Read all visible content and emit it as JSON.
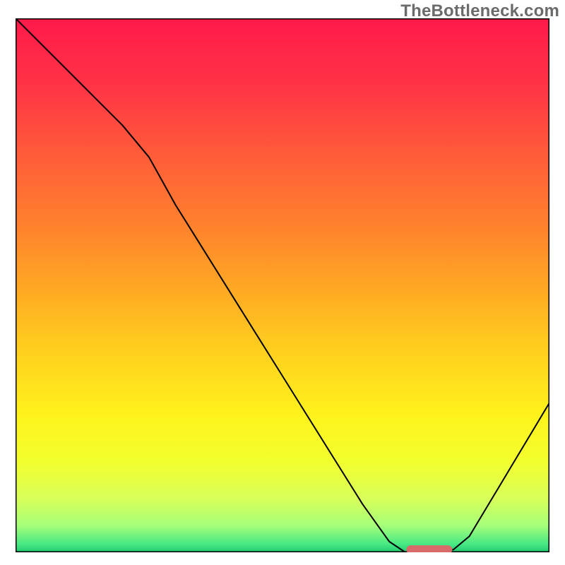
{
  "watermark": "TheBottleneck.com",
  "chart_data": {
    "type": "line",
    "title": "",
    "xlabel": "",
    "ylabel": "",
    "xlim": [
      0,
      100
    ],
    "ylim": [
      0,
      100
    ],
    "grid": false,
    "legend": false,
    "x": [
      0,
      5,
      10,
      15,
      20,
      25,
      30,
      35,
      40,
      45,
      50,
      55,
      60,
      65,
      70,
      73,
      76,
      79,
      82,
      85,
      88,
      91,
      94,
      97,
      100
    ],
    "values": [
      100,
      95,
      90,
      85,
      80,
      74,
      65,
      57,
      49,
      41,
      33,
      25,
      17,
      9,
      2,
      0,
      0,
      0,
      0.5,
      3,
      8,
      13,
      18,
      23,
      28
    ],
    "line_color": "#000000",
    "line_width": 2,
    "marker": {
      "x_range": [
        74,
        81
      ],
      "y": 0.5,
      "color": "#d96a6a",
      "thickness": 1.6
    },
    "background_gradient": {
      "stops": [
        {
          "offset": 0.0,
          "color": "#ff1a4a"
        },
        {
          "offset": 0.12,
          "color": "#ff3246"
        },
        {
          "offset": 0.25,
          "color": "#ff5a3a"
        },
        {
          "offset": 0.38,
          "color": "#ff7f2e"
        },
        {
          "offset": 0.5,
          "color": "#ffa624"
        },
        {
          "offset": 0.62,
          "color": "#ffcf1e"
        },
        {
          "offset": 0.74,
          "color": "#fff21c"
        },
        {
          "offset": 0.83,
          "color": "#f2ff2e"
        },
        {
          "offset": 0.9,
          "color": "#d8ff5a"
        },
        {
          "offset": 0.95,
          "color": "#a6ff7a"
        },
        {
          "offset": 0.985,
          "color": "#46e884"
        },
        {
          "offset": 1.0,
          "color": "#1fc96f"
        }
      ]
    },
    "border_color": "#000000",
    "border_width": 3
  }
}
